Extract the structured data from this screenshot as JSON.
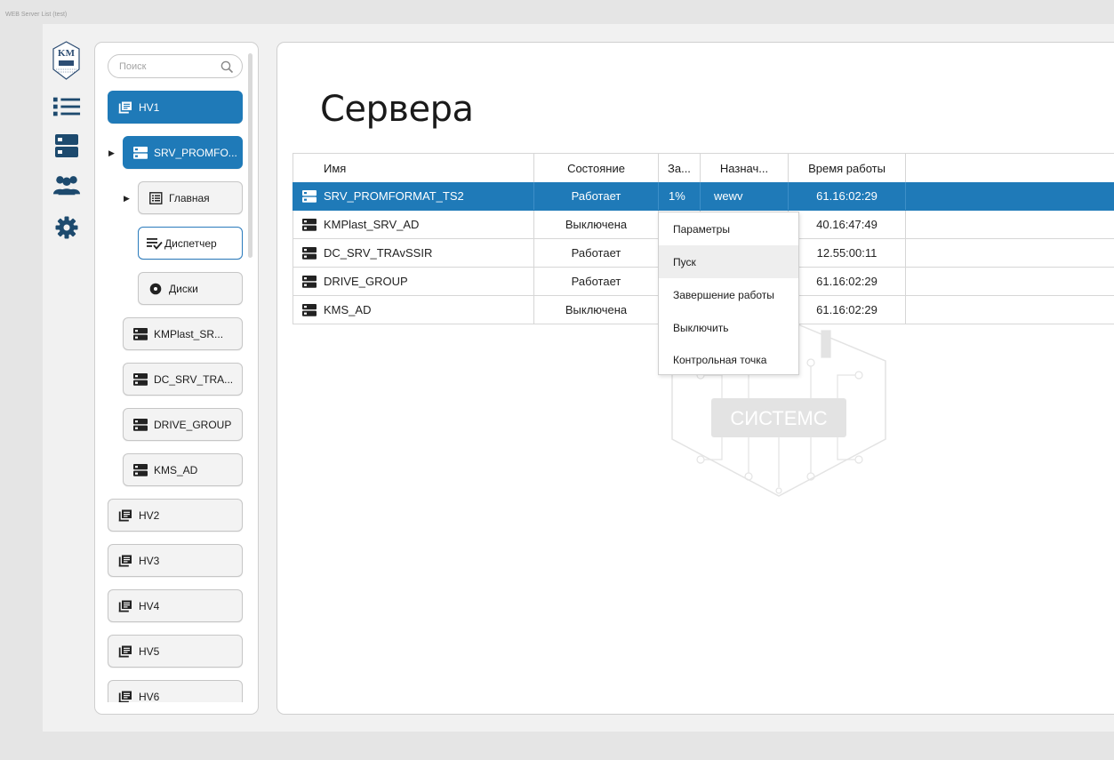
{
  "window": {
    "title": "WEB Server List (test)"
  },
  "colors": {
    "accent": "#1f7ab8",
    "rail_icon": "#1d4a6e",
    "border": "#d6d6d6"
  },
  "rail": {
    "logo": {
      "icon": "km-systems-logo-icon",
      "text": "KM"
    },
    "items": [
      {
        "name": "list-icon"
      },
      {
        "name": "server-icon"
      },
      {
        "name": "users-icon"
      },
      {
        "name": "gear-icon"
      }
    ]
  },
  "tree": {
    "search_placeholder": "Поиск",
    "hv_groups": [
      {
        "label": "HV1",
        "expanded": true
      },
      {
        "label": "HV2"
      },
      {
        "label": "HV3"
      },
      {
        "label": "HV4"
      },
      {
        "label": "HV5"
      },
      {
        "label": "HV6"
      }
    ],
    "servers": [
      {
        "label": "SRV_PROMFO..."
      },
      {
        "label": "KMPlast_SR..."
      },
      {
        "label": "DC_SRV_TRA..."
      },
      {
        "label": "DRIVE_GROUP"
      },
      {
        "label": "KMS_AD"
      }
    ],
    "sub_items": [
      {
        "label": "Главная"
      },
      {
        "label": "Диспетчер"
      },
      {
        "label": "Диски"
      }
    ]
  },
  "main": {
    "title": "Сервера",
    "table": {
      "columns": [
        "Имя",
        "Состояние",
        "За...",
        "Назнач...",
        "Время работы"
      ],
      "rows": [
        {
          "name": "SRV_PROMFORMAT_TS2",
          "state": "Работает",
          "load": "1%",
          "assign": "wewv",
          "uptime": "61.16:02:29"
        },
        {
          "name": "KMPlast_SRV_AD",
          "state": "Выключена",
          "load": "",
          "assign": "",
          "uptime": "40.16:47:49"
        },
        {
          "name": "DC_SRV_TRAvSSIR",
          "state": "Работает",
          "load": "",
          "assign": "",
          "uptime": "12.55:00:11"
        },
        {
          "name": "DRIVE_GROUP",
          "state": "Работает",
          "load": "",
          "assign": "",
          "uptime": "61.16:02:29"
        },
        {
          "name": "KMS_AD",
          "state": "Выключена",
          "load": "",
          "assign": "",
          "uptime": "61.16:02:29"
        }
      ]
    },
    "context_menu": {
      "items": [
        "Параметры",
        "Пуск",
        "Завершение работы",
        "Выключить",
        "Контрольная точка"
      ]
    },
    "watermark": {
      "text": "СИСТЕМС"
    }
  }
}
